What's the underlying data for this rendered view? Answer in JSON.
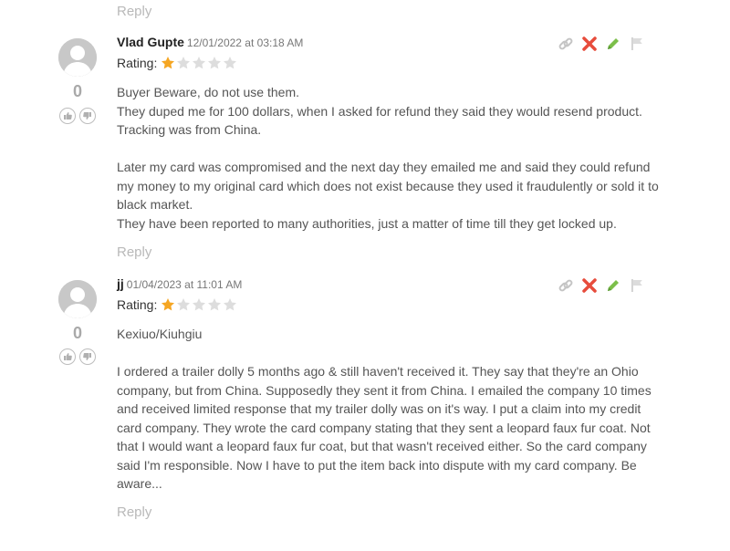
{
  "reply_label": "Reply",
  "rating_label": "Rating:",
  "colors": {
    "star_filled": "#f5a623",
    "star_empty": "#dddddd",
    "delete": "#e74c3c",
    "edit": "#7cbf4a"
  },
  "comments": [
    {
      "author": "Vlad Gupte",
      "date": "12/01/2022 at 03:18 AM",
      "rating": 1,
      "rating_max": 5,
      "votes": "0",
      "paragraphs": [
        "Buyer Beware, do not use them.",
        "They duped me for 100 dollars, when I asked for refund they said they would resend product. Tracking was from China.",
        "",
        "Later my card was compromised and the next day they emailed me and said they could refund my money to my original card which does not exist because they used it fraudulently or sold it to black market.",
        "They have been reported to many authorities, just a matter of time till they get locked up."
      ]
    },
    {
      "author": "jj",
      "date": "01/04/2023 at 11:01 AM",
      "rating": 1,
      "rating_max": 5,
      "votes": "0",
      "paragraphs": [
        "Kexiuo/Kiuhgiu",
        "",
        "I ordered a trailer dolly 5 months ago & still haven't received it. They say that they're an Ohio company, but from China. Supposedly they sent it from China. I emailed the company 10 times and received limited response that my trailer dolly was on it's way. I put a claim into my credit card company. They wrote the card company stating that they sent a leopard faux fur coat. Not that I would want a leopard faux fur coat, but that wasn't received either. So the card company said I'm responsible. Now I have to put the item back into dispute with my card company. Be aware..."
      ]
    }
  ]
}
